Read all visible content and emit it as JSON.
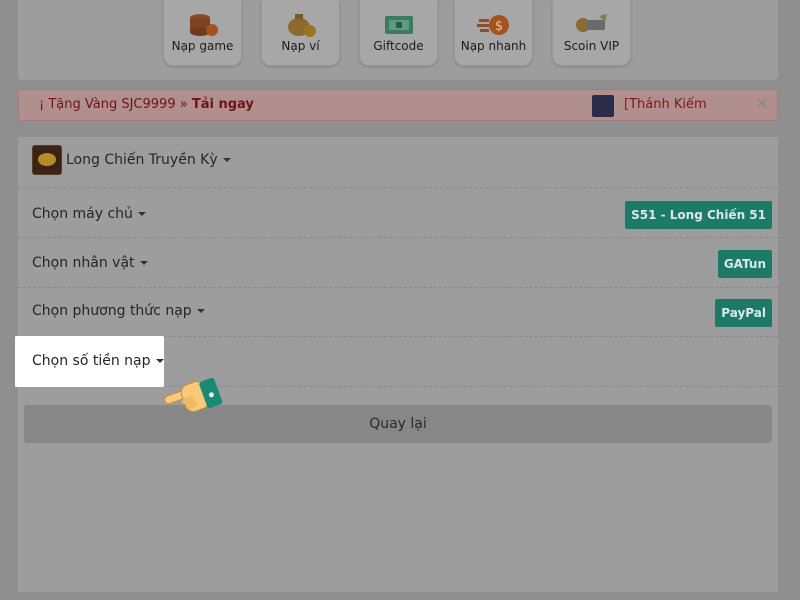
{
  "top_menu": {
    "items": [
      {
        "label": "Nạp game",
        "icon": "coin-stack-icon"
      },
      {
        "label": "Nạp ví",
        "icon": "money-bag-icon"
      },
      {
        "label": "Giftcode",
        "icon": "ticket-icon"
      },
      {
        "label": "Nạp nhanh",
        "icon": "fast-coin-icon"
      },
      {
        "label": "Scoin VIP",
        "icon": "scoin-icon"
      }
    ]
  },
  "promo": {
    "prefix": "¡ Tặng Vàng SJC9999 » ",
    "cta": "Tải ngay",
    "right_text": "[Thánh Kiếm",
    "close": "✕"
  },
  "form": {
    "game": "Long Chiến Truyền Kỳ",
    "server_label": "Chọn máy chủ",
    "server_value": "S51 - Long Chiến 51",
    "character_label": "Chọn nhân vật",
    "character_value": "GATun",
    "method_label": "Chọn phương thức nạp",
    "method_value": "PayPal",
    "amount_label": "Chọn số tiền nạp",
    "back_label": "Quay lại"
  },
  "colors": {
    "tag_green": "#1d7a68",
    "highlight": "#ffffff",
    "hand": "#f7c97a",
    "cuff": "#1a8a74"
  }
}
